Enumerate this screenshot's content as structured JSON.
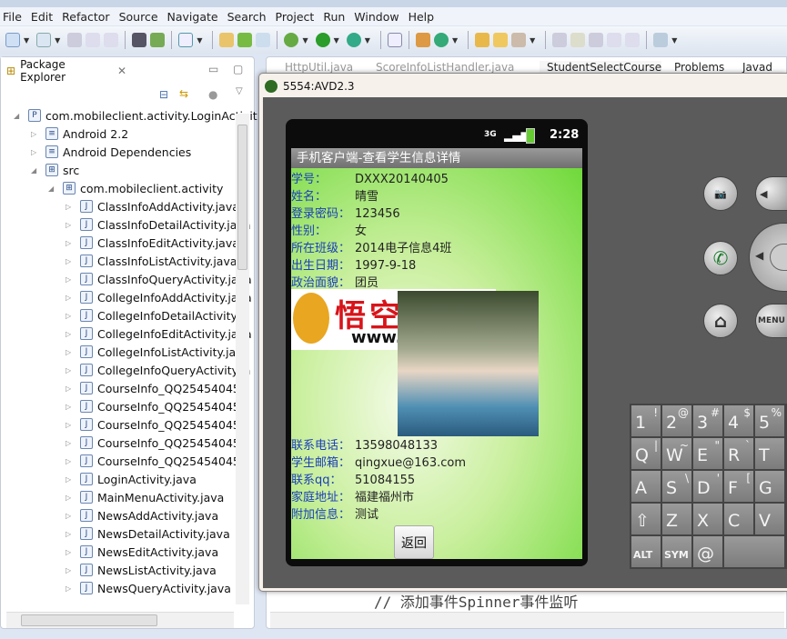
{
  "menu": [
    "File",
    "Edit",
    "Refactor",
    "Source",
    "Navigate",
    "Search",
    "Project",
    "Run",
    "Window",
    "Help"
  ],
  "package_explorer": {
    "title": "Package Explorer",
    "project": "com.mobileclient.activity.LoginActivit",
    "items": [
      {
        "label": "Android 2.2",
        "level": 1,
        "icon": "library-icon"
      },
      {
        "label": "Android Dependencies",
        "level": 1,
        "icon": "library-icon"
      },
      {
        "label": "src",
        "level": 1,
        "icon": "source-folder-icon",
        "expanded": true
      },
      {
        "label": "com.mobileclient.activity",
        "level": 2,
        "icon": "package-icon",
        "expanded": true
      },
      {
        "label": "ClassInfoAddActivity.java",
        "level": 3
      },
      {
        "label": "ClassInfoDetailActivity.java",
        "level": 3
      },
      {
        "label": "ClassInfoEditActivity.java",
        "level": 3
      },
      {
        "label": "ClassInfoListActivity.java",
        "level": 3
      },
      {
        "label": "ClassInfoQueryActivity.java",
        "level": 3
      },
      {
        "label": "CollegeInfoAddActivity.java",
        "level": 3
      },
      {
        "label": "CollegeInfoDetailActivity.ja",
        "level": 3
      },
      {
        "label": "CollegeInfoEditActivity.java",
        "level": 3
      },
      {
        "label": "CollegeInfoListActivity.java",
        "level": 3
      },
      {
        "label": "CollegeInfoQueryActivity.ja",
        "level": 3
      },
      {
        "label": "CourseInfo_QQ254540457",
        "level": 3
      },
      {
        "label": "CourseInfo_QQ254540457",
        "level": 3
      },
      {
        "label": "CourseInfo_QQ254540457",
        "level": 3
      },
      {
        "label": "CourseInfo_QQ254540457",
        "level": 3
      },
      {
        "label": "CourseInfo_QQ254540457",
        "level": 3
      },
      {
        "label": "LoginActivity.java",
        "level": 3
      },
      {
        "label": "MainMenuActivity.java",
        "level": 3
      },
      {
        "label": "NewsAddActivity.java",
        "level": 3
      },
      {
        "label": "NewsDetailActivity.java",
        "level": 3
      },
      {
        "label": "NewsEditActivity.java",
        "level": 3
      },
      {
        "label": "NewsListActivity.java",
        "level": 3
      },
      {
        "label": "NewsQueryActivity.java",
        "level": 3
      }
    ]
  },
  "editor": {
    "tabs": [
      "HttpUtil.java",
      "ScoreInfoListHandler.java",
      "StudentSelectCourse",
      "Problems",
      "Javad"
    ],
    "code_line": "// 添加事件Spinner事件监听"
  },
  "emulator": {
    "title": "5554:AVD2.3",
    "status": {
      "network": "3G",
      "time": "2:28"
    },
    "app_title": "手机客户端-查看学生信息详情",
    "fields_top": [
      {
        "label": "学号：",
        "value": "DXXX20140405"
      },
      {
        "label": "姓名：",
        "value": "晴雪"
      },
      {
        "label": "登录密码：",
        "value": "123456"
      },
      {
        "label": "性别：",
        "value": "女"
      },
      {
        "label": "所在班级：",
        "value": "2014电子信息4班"
      },
      {
        "label": "出生日期：",
        "value": "1997-9-18"
      },
      {
        "label": "政治面貌：",
        "value": "团员"
      }
    ],
    "fields_bottom": [
      {
        "label": "联系电话：",
        "value": "13598048133"
      },
      {
        "label": "学生邮箱：",
        "value": "qingxue@163.com"
      },
      {
        "label": "联系qq：",
        "value": "51084155"
      },
      {
        "label": "家庭地址：",
        "value": "福建福州市"
      },
      {
        "label": "附加信息：",
        "value": "测试"
      }
    ],
    "back_button": "返回",
    "watermark": {
      "cn": "悟空源码",
      "url": "www.5kym.com"
    },
    "hw_buttons": {
      "menu": "MENU"
    },
    "keyboard": [
      [
        "1",
        "2",
        "3",
        "4",
        "5"
      ],
      [
        "Q",
        "W",
        "E",
        "R",
        "T"
      ],
      [
        "A",
        "S",
        "D",
        "F",
        "G"
      ],
      [
        "⇧",
        "Z",
        "X",
        "C",
        "V"
      ],
      [
        "ALT",
        "SYM",
        "@"
      ]
    ],
    "keyboard_alt": [
      [
        "!",
        "@",
        "#",
        "$",
        "%"
      ],
      [
        "|",
        "~",
        "\"",
        "`",
        ""
      ],
      [
        "",
        "\\",
        "'",
        "[",
        ""
      ]
    ]
  }
}
